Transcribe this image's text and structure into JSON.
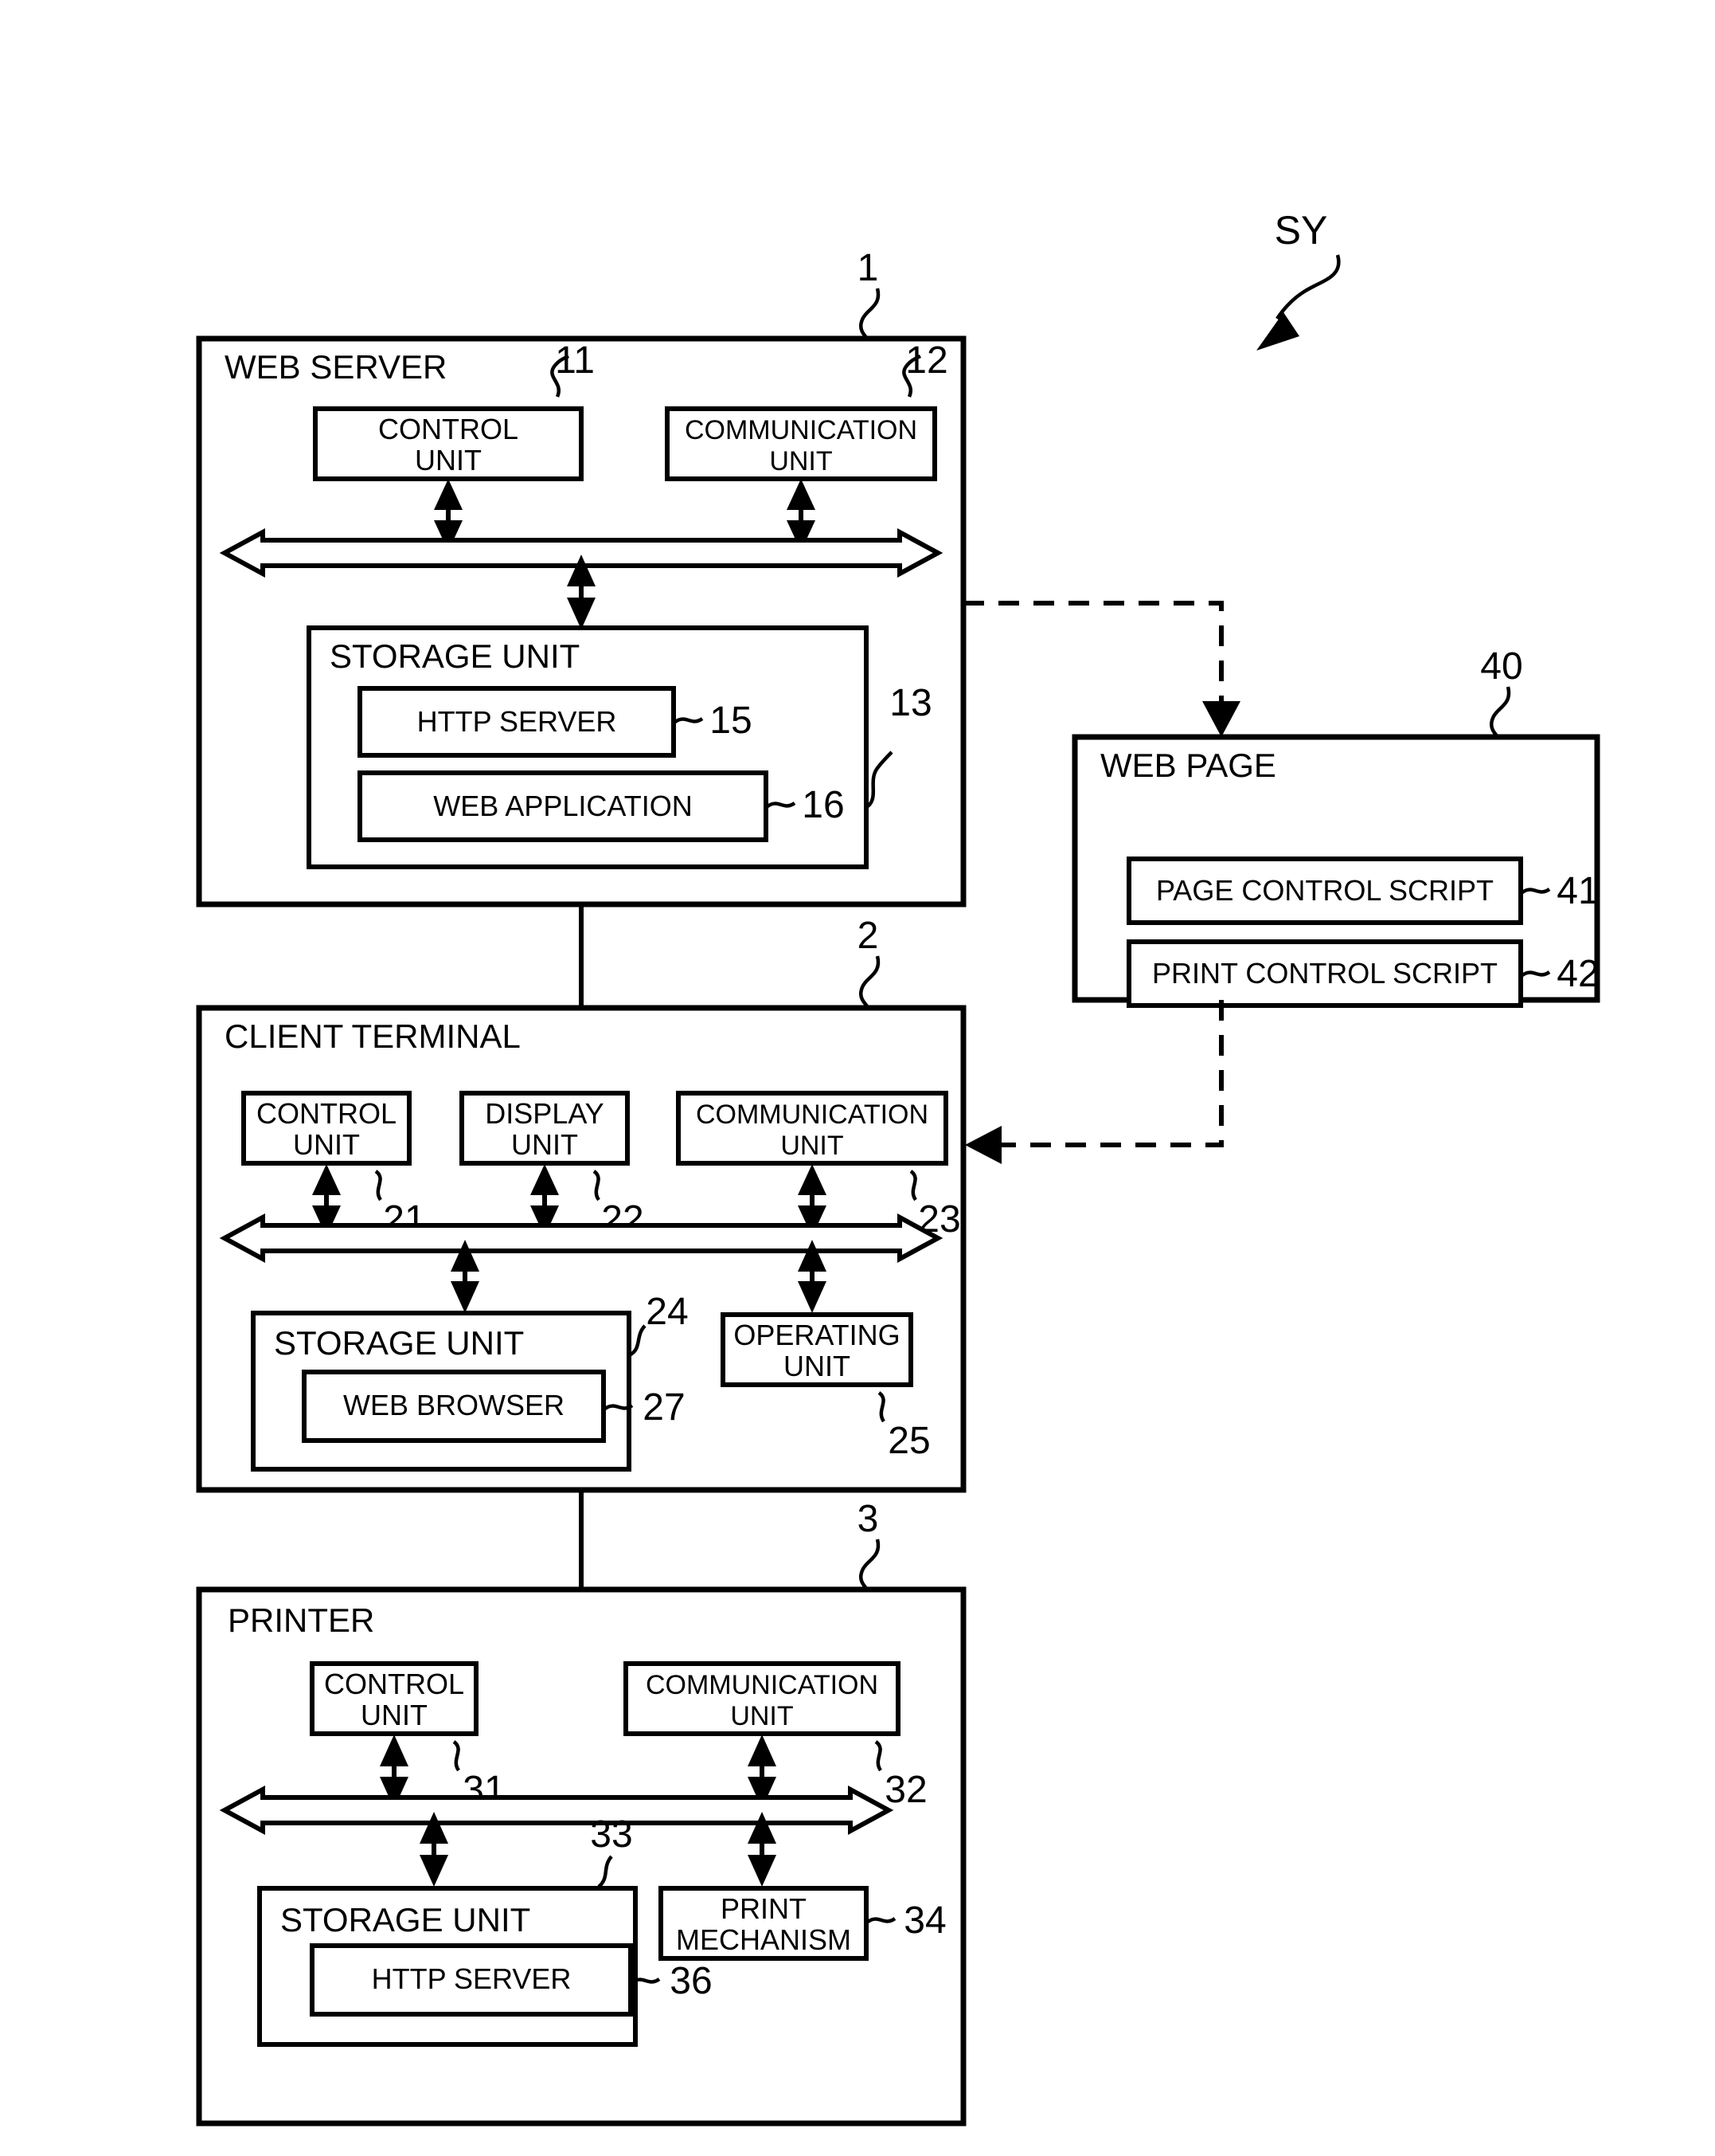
{
  "figure": {
    "system_label": "SY",
    "system_ref": "SY"
  },
  "web_server": {
    "title": "WEB SERVER",
    "ref": "1",
    "control_unit": {
      "label": "CONTROL\nUNIT",
      "line1": "CONTROL",
      "line2": "UNIT",
      "ref": "11"
    },
    "communication_unit": {
      "label": "COMMUNICATION\nUNIT",
      "line1": "COMMUNICATION",
      "line2": "UNIT",
      "ref": "12"
    },
    "storage_unit": {
      "title": "STORAGE UNIT",
      "ref": "13"
    },
    "http_server": {
      "label": "HTTP SERVER",
      "ref": "15"
    },
    "web_application": {
      "label": "WEB APPLICATION",
      "ref": "16"
    }
  },
  "web_page": {
    "title": "WEB PAGE",
    "ref": "40",
    "page_control_script": {
      "label": "PAGE CONTROL SCRIPT",
      "ref": "41"
    },
    "print_control_script": {
      "label": "PRINT CONTROL SCRIPT",
      "ref": "42"
    }
  },
  "client_terminal": {
    "title": "CLIENT TERMINAL",
    "ref": "2",
    "control_unit": {
      "line1": "CONTROL",
      "line2": "UNIT",
      "ref": "21"
    },
    "display_unit": {
      "line1": "DISPLAY",
      "line2": "UNIT",
      "ref": "22"
    },
    "communication_unit": {
      "line1": "COMMUNICATION",
      "line2": "UNIT",
      "ref": "23"
    },
    "storage_unit": {
      "title": "STORAGE UNIT",
      "ref": "24"
    },
    "web_browser": {
      "label": "WEB BROWSER",
      "ref": "27"
    },
    "operating_unit": {
      "line1": "OPERATING",
      "line2": "UNIT",
      "ref": "25"
    }
  },
  "printer": {
    "title": "PRINTER",
    "ref": "3",
    "control_unit": {
      "line1": "CONTROL",
      "line2": "UNIT",
      "ref": "31"
    },
    "communication_unit": {
      "line1": "COMMUNICATION",
      "line2": "UNIT",
      "ref": "32"
    },
    "storage_unit": {
      "title": "STORAGE UNIT",
      "ref": "33"
    },
    "http_server": {
      "label": "HTTP SERVER",
      "ref": "36"
    },
    "print_mechanism": {
      "line1": "PRINT",
      "line2": "MECHANISM",
      "ref": "34"
    }
  },
  "colors": {
    "stroke": "#000000",
    "background": "#ffffff"
  }
}
